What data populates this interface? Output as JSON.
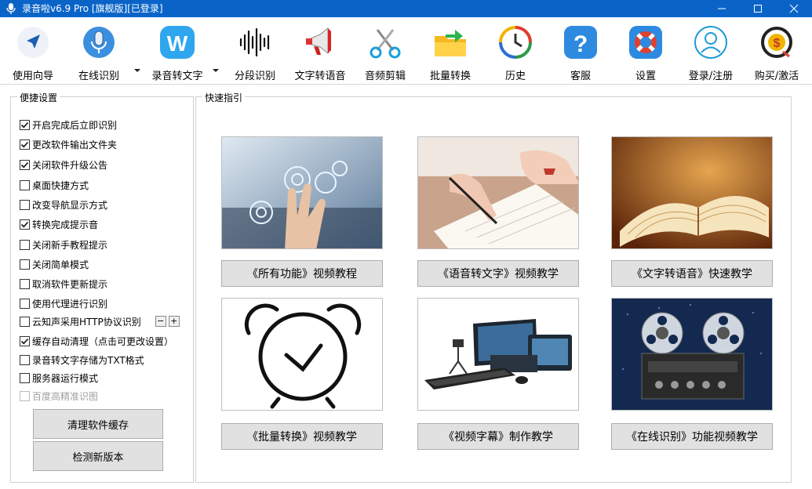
{
  "window": {
    "title": "录音啦v6.9 Pro [旗舰版][已登录]",
    "colors": {
      "titlebar": "#0a64c8",
      "button_face": "#e1e1e1"
    }
  },
  "toolbar": {
    "items": [
      {
        "label": "使用向导",
        "icon": "navigate-arrow-icon"
      },
      {
        "label": "在线识别",
        "icon": "microphone-icon"
      },
      {
        "label": "录音转文字",
        "icon": "w-logo-icon"
      },
      {
        "label": "分段识别",
        "icon": "waveform-icon"
      },
      {
        "label": "文字转语音",
        "icon": "megaphone-icon"
      },
      {
        "label": "音频剪辑",
        "icon": "scissors-icon"
      },
      {
        "label": "批量转换",
        "icon": "folder-arrow-icon"
      },
      {
        "label": "历史",
        "icon": "history-clock-icon"
      },
      {
        "label": "客服",
        "icon": "help-question-icon"
      },
      {
        "label": "设置",
        "icon": "lifebuoy-icon"
      },
      {
        "label": "登录/注册",
        "icon": "user-icon"
      },
      {
        "label": "购买/激活",
        "icon": "dollar-clock-icon"
      }
    ]
  },
  "settings": {
    "title": "便捷设置",
    "options": [
      {
        "label": "开启完成后立即识别",
        "checked": true
      },
      {
        "label": "更改软件输出文件夹",
        "checked": true
      },
      {
        "label": "关闭软件升级公告",
        "checked": true
      },
      {
        "label": "桌面快捷方式",
        "checked": false
      },
      {
        "label": "改变导航显示方式",
        "checked": false
      },
      {
        "label": "转换完成提示音",
        "checked": true
      },
      {
        "label": "关闭新手教程提示",
        "checked": false
      },
      {
        "label": "关闭简单模式",
        "checked": false
      },
      {
        "label": "取消软件更新提示",
        "checked": false
      },
      {
        "label": "使用代理进行识别",
        "checked": false
      },
      {
        "label": "云知声采用HTTP协议识别",
        "checked": false
      },
      {
        "label": "缓存自动清理（点击可更改设置）",
        "checked": true
      },
      {
        "label": "录音转文字存储为TXT格式",
        "checked": false
      },
      {
        "label": "服务器运行模式",
        "checked": false
      },
      {
        "label": "百度高精准识图",
        "checked": false,
        "disabled": true
      }
    ],
    "stepper": {
      "minus": "−",
      "plus": "+"
    },
    "clear_cache_label": "清理软件缓存",
    "check_update_label": "检测新版本"
  },
  "guide": {
    "title": "快速指引",
    "cards": [
      {
        "button": "《所有功能》视频教程",
        "image": "touch-screen-hand"
      },
      {
        "button": "《语音转文字》视频教学",
        "image": "hand-writing-notebook"
      },
      {
        "button": "《文字转语音》快速教学",
        "image": "open-book"
      },
      {
        "button": "《批量转换》视频教学",
        "image": "alarm-clock"
      },
      {
        "button": "《视频字幕》制作教学",
        "image": "video-production-setup"
      },
      {
        "button": "《在线识别》功能视频教学",
        "image": "reel-to-reel-tape-recorder"
      }
    ]
  }
}
